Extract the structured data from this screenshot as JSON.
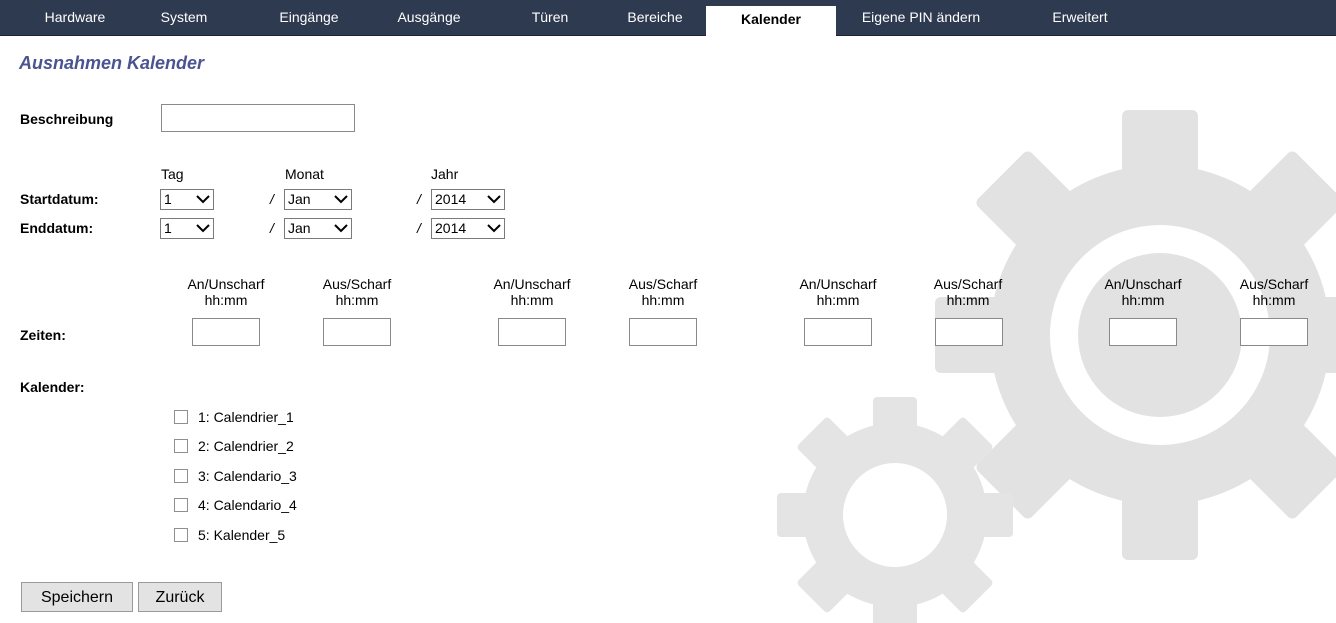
{
  "nav": {
    "tabs": [
      {
        "label": "Hardware"
      },
      {
        "label": "System"
      },
      {
        "label": "Eingänge"
      },
      {
        "label": "Ausgänge"
      },
      {
        "label": "Türen"
      },
      {
        "label": "Bereiche"
      },
      {
        "label": "Kalender",
        "active": true
      },
      {
        "label": "Eigene PIN ändern"
      },
      {
        "label": "Erweitert"
      }
    ]
  },
  "page": {
    "title": "Ausnahmen Kalender"
  },
  "description": {
    "label": "Beschreibung",
    "value": ""
  },
  "dates": {
    "col_day": "Tag",
    "col_month": "Monat",
    "col_year": "Jahr",
    "separator": "/",
    "start": {
      "label": "Startdatum:",
      "day": "1",
      "month": "Jan",
      "year": "2014"
    },
    "end": {
      "label": "Enddatum:",
      "day": "1",
      "month": "Jan",
      "year": "2014"
    }
  },
  "times": {
    "label": "Zeiten:",
    "headers": [
      {
        "line1": "An/Unscharf",
        "line2": "hh:mm"
      },
      {
        "line1": "Aus/Scharf",
        "line2": "hh:mm"
      },
      {
        "line1": "An/Unscharf",
        "line2": "hh:mm"
      },
      {
        "line1": "Aus/Scharf",
        "line2": "hh:mm"
      },
      {
        "line1": "An/Unscharf",
        "line2": "hh:mm"
      },
      {
        "line1": "Aus/Scharf",
        "line2": "hh:mm"
      },
      {
        "line1": "An/Unscharf",
        "line2": "hh:mm"
      },
      {
        "line1": "Aus/Scharf",
        "line2": "hh:mm"
      }
    ]
  },
  "calendars": {
    "label": "Kalender:",
    "items": [
      {
        "label": "1: Calendrier_1",
        "checked": false
      },
      {
        "label": "2: Calendrier_2",
        "checked": false
      },
      {
        "label": "3: Calendario_3",
        "checked": false
      },
      {
        "label": "4: Calendario_4",
        "checked": false
      },
      {
        "label": "5: Kalender_5",
        "checked": false
      }
    ]
  },
  "actions": {
    "save": "Speichern",
    "back": "Zurück"
  },
  "icons": {
    "dropdown": "chevron-down-icon",
    "background": "gear-icon"
  },
  "colors": {
    "nav_bg": "#2e3a4f",
    "title": "#4a5590",
    "gear": "#e3e3e3"
  }
}
